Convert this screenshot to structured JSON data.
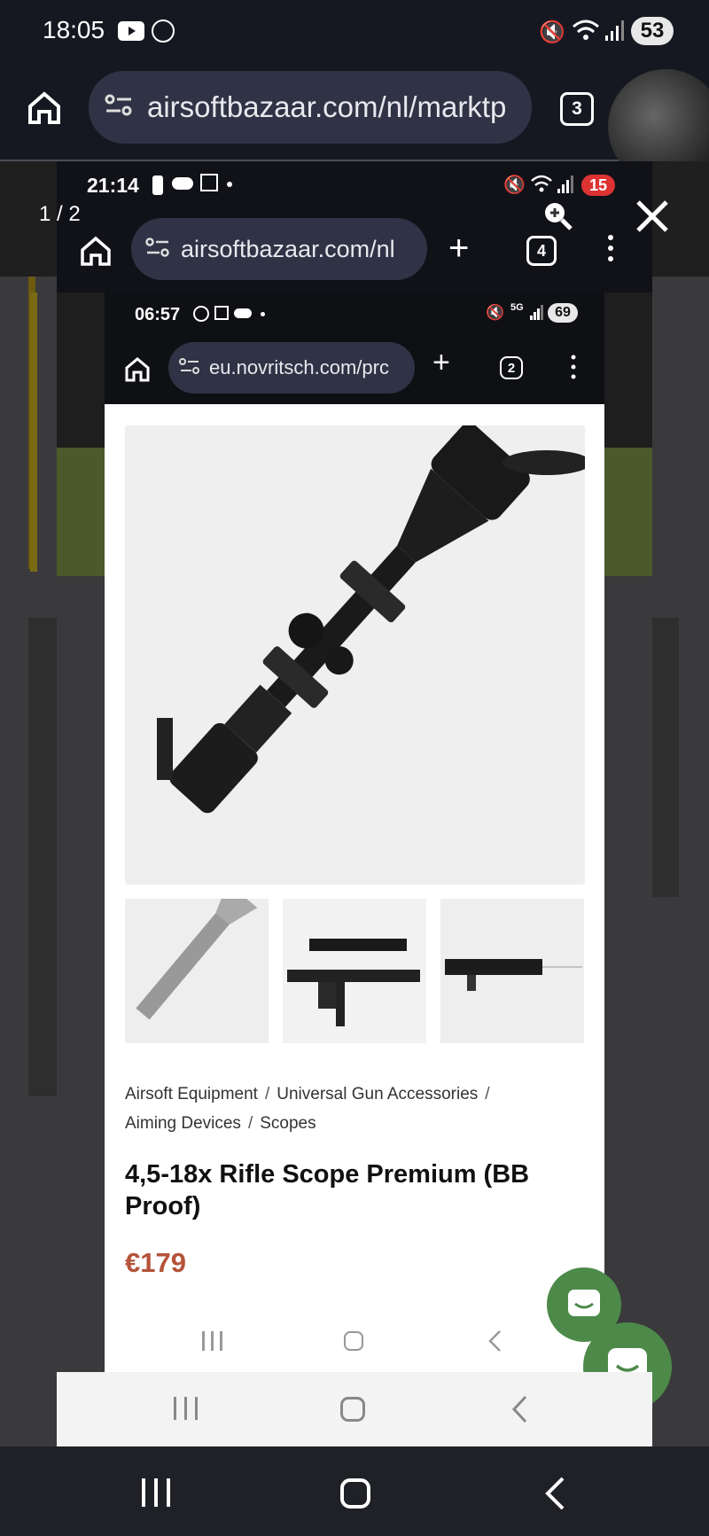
{
  "outer": {
    "status": {
      "time": "18:05",
      "battery": "53"
    },
    "browser": {
      "url": "airsoftbazaar.com/nl/marktp",
      "tabs": "3"
    }
  },
  "viewer": {
    "counter": "1 / 2"
  },
  "middle": {
    "status": {
      "time": "21:14",
      "battery": "15"
    },
    "browser": {
      "url": "airsoftbazaar.com/nl",
      "tabs": "4"
    }
  },
  "inner": {
    "status": {
      "time": "06:57",
      "network": "5G",
      "battery": "69"
    },
    "browser": {
      "url": "eu.novritsch.com/prc",
      "tabs": "2"
    },
    "product": {
      "breadcrumb": [
        "Airsoft Equipment",
        "Universal Gun Accessories",
        "Aiming Devices",
        "Scopes"
      ],
      "title_line1": "4,5-18x Rifle Scope Premium (BB",
      "title_line2": "Proof)",
      "price": "€179",
      "price_color": "#b5533a"
    }
  },
  "colors": {
    "accent_green": "#4d8a4a",
    "dark_bar": "#161821"
  }
}
